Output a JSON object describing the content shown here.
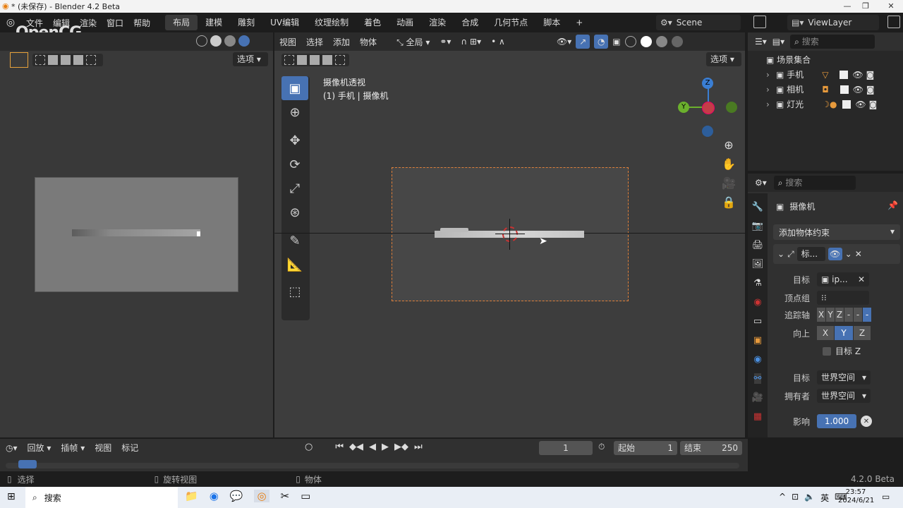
{
  "window": {
    "title": "* (未保存) - Blender 4.2 Beta"
  },
  "menu": {
    "items": [
      "文件",
      "编辑",
      "渲染",
      "窗口",
      "帮助"
    ]
  },
  "workspaces": [
    "布局",
    "建模",
    "雕刻",
    "UV编辑",
    "纹理绘制",
    "着色",
    "动画",
    "渲染",
    "合成",
    "几何节点",
    "脚本"
  ],
  "scene": {
    "name": "Scene",
    "view_layer": "ViewLayer"
  },
  "watermark": "OpenCG",
  "left_viewport": {
    "options": "选项"
  },
  "viewport": {
    "menus": [
      "视图",
      "选择",
      "添加",
      "物体"
    ],
    "orientation": "全局",
    "options": "选项",
    "overlay_title": "摄像机透视",
    "overlay_sub": "(1) 手机 | 摄像机",
    "axes": {
      "z": "Z",
      "y": "Y"
    }
  },
  "outliner": {
    "search_placeholder": "搜索",
    "root": "场景集合",
    "items": [
      "手机",
      "相机",
      "灯光"
    ]
  },
  "properties": {
    "search_placeholder": "搜索",
    "object_name": "摄像机",
    "add_constraint": "添加物体约束",
    "constraint_name": "标...",
    "target_label": "目标",
    "target_value": "ip...",
    "vgroup_label": "顶点组",
    "track_label": "追踪轴",
    "track_axes": [
      "X",
      "Y",
      "Z",
      "-",
      "-",
      "-"
    ],
    "up_label": "向上",
    "up_axes": [
      "X",
      "Y",
      "Z"
    ],
    "target_z": "目标 Z",
    "target_space_label": "目标",
    "target_space": "世界空间",
    "owner_space_label": "拥有者",
    "owner_space": "世界空间",
    "influence_label": "影响",
    "influence": "1.000"
  },
  "timeline": {
    "menus": [
      "回放",
      "插帧",
      "视图",
      "标记"
    ],
    "current": "1",
    "start_label": "起始",
    "start": "1",
    "end_label": "结束",
    "end": "250"
  },
  "statusbar": {
    "select": "选择",
    "rotate": "旋转视图",
    "object": "物体",
    "version": "4.2.0 Beta"
  },
  "taskbar": {
    "search": "搜索",
    "lang": "英",
    "time": "23:57",
    "date": "2024/6/21"
  }
}
